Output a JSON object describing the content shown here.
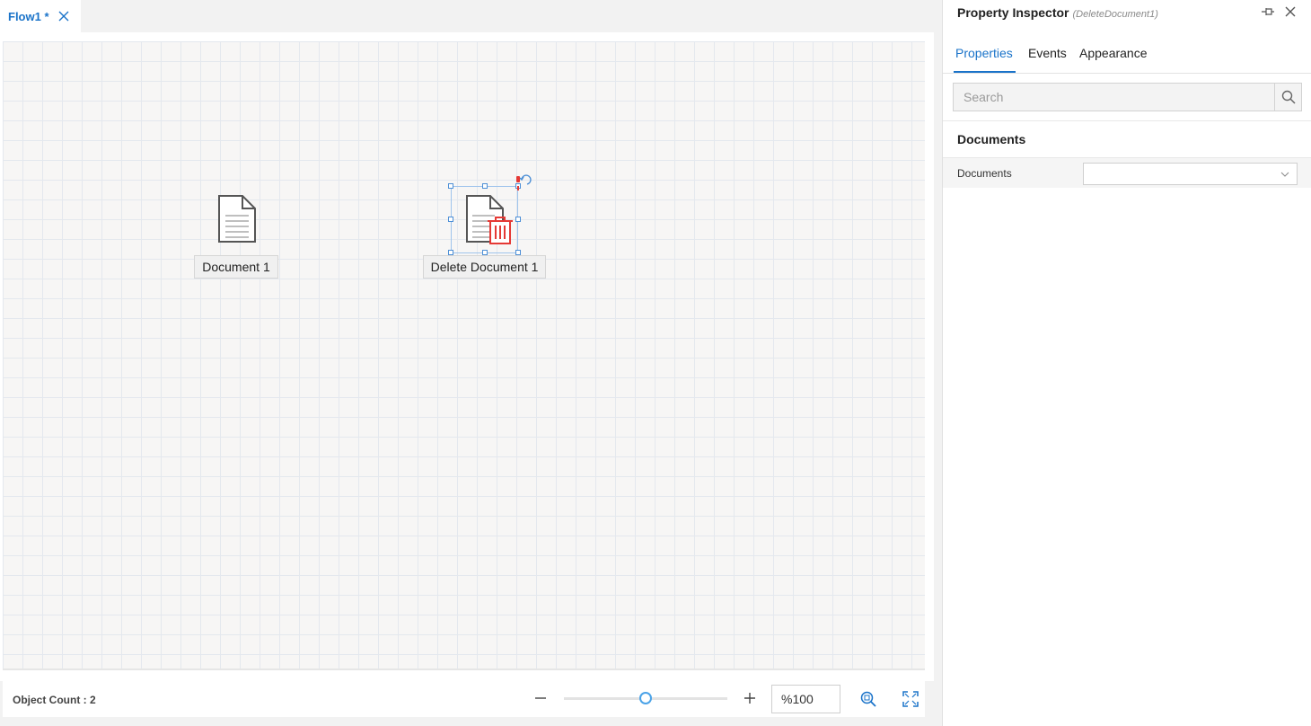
{
  "tab": {
    "label": "Flow1 *"
  },
  "canvas": {
    "nodes": [
      {
        "label": "Document 1",
        "icon": "document-icon"
      },
      {
        "label": "Delete Document 1",
        "icon": "delete-document-icon",
        "selected": true
      }
    ]
  },
  "status": {
    "object_count": "Object Count : 2",
    "zoom_value": "%100",
    "zoom_slider_level": 0.5
  },
  "inspector": {
    "title": "Property Inspector",
    "subtitle": "(DeleteDocument1)",
    "tabs": [
      "Properties",
      "Events",
      "Appearance"
    ],
    "active_tab": "Properties",
    "search_placeholder": "Search",
    "section_title": "Documents",
    "properties": [
      {
        "label": "Documents",
        "value": ""
      }
    ]
  },
  "colors": {
    "accent": "#1a73c9",
    "delete_red": "#e53935",
    "slider_thumb": "#4ba3e8"
  }
}
